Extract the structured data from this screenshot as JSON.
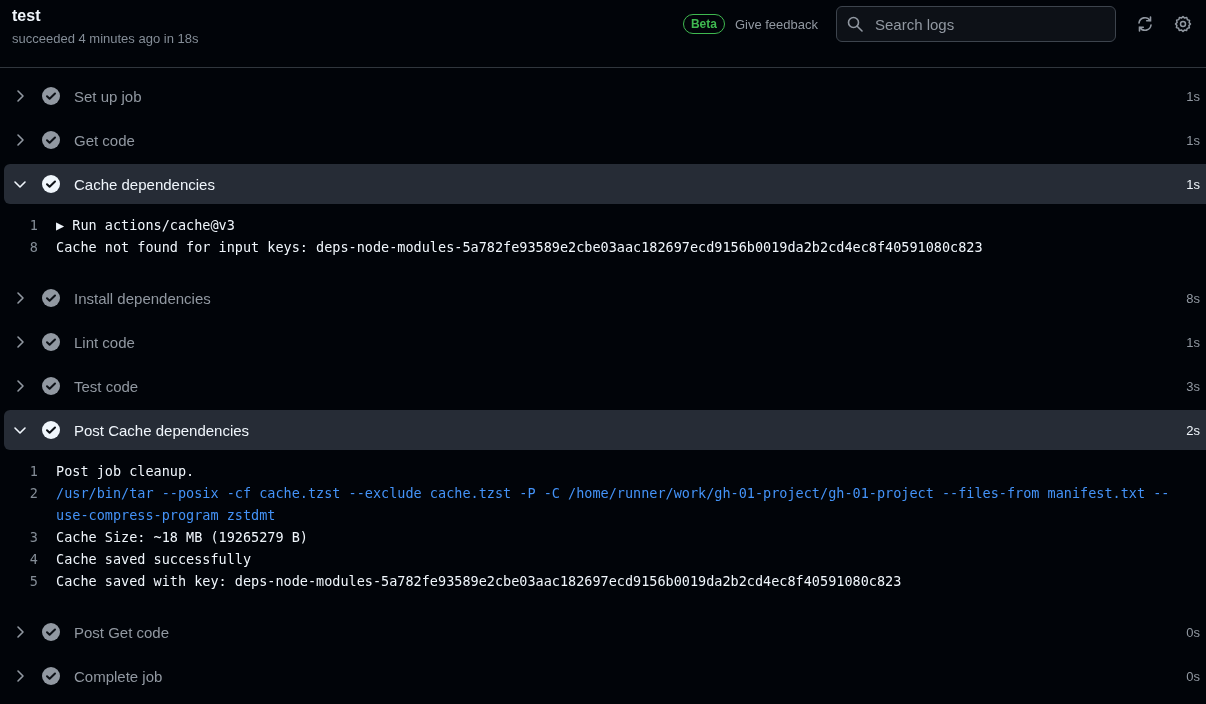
{
  "job": {
    "title": "test",
    "status": "succeeded 4 minutes ago in 18s"
  },
  "toolbar": {
    "badge": "Beta",
    "feedback": "Give feedback",
    "search": {
      "placeholder": "Search logs"
    }
  },
  "steps": [
    {
      "label": "Set up job",
      "duration": "1s",
      "expanded": false
    },
    {
      "label": "Get code",
      "duration": "1s",
      "expanded": false
    },
    {
      "label": "Cache dependencies",
      "duration": "1s",
      "expanded": true,
      "lines": [
        {
          "number": "1",
          "text": "▶ Run actions/cache@v3",
          "kind": "plain"
        },
        {
          "number": "8",
          "text": "Cache not found for input keys: deps-node-modules-5a782fe93589e2cbe03aac182697ecd9156b0019da2b2cd4ec8f40591080c823",
          "kind": "plain"
        }
      ]
    },
    {
      "label": "Install dependencies",
      "duration": "8s",
      "expanded": false
    },
    {
      "label": "Lint code",
      "duration": "1s",
      "expanded": false
    },
    {
      "label": "Test code",
      "duration": "3s",
      "expanded": false
    },
    {
      "label": "Post Cache dependencies",
      "duration": "2s",
      "expanded": true,
      "lines": [
        {
          "number": "1",
          "text": "Post job cleanup.",
          "kind": "plain"
        },
        {
          "number": "2",
          "text": "/usr/bin/tar --posix -cf cache.tzst --exclude cache.tzst -P -C /home/runner/work/gh-01-project/gh-01-project --files-from manifest.txt --use-compress-program zstdmt",
          "kind": "command"
        },
        {
          "number": "3",
          "text": "Cache Size: ~18 MB (19265279 B)",
          "kind": "plain"
        },
        {
          "number": "4",
          "text": "Cache saved successfully",
          "kind": "plain"
        },
        {
          "number": "5",
          "text": "Cache saved with key: deps-node-modules-5a782fe93589e2cbe03aac182697ecd9156b0019da2b2cd4ec8f40591080c823",
          "kind": "plain"
        }
      ]
    },
    {
      "label": "Post Get code",
      "duration": "0s",
      "expanded": false
    },
    {
      "label": "Complete job",
      "duration": "0s",
      "expanded": false
    }
  ]
}
